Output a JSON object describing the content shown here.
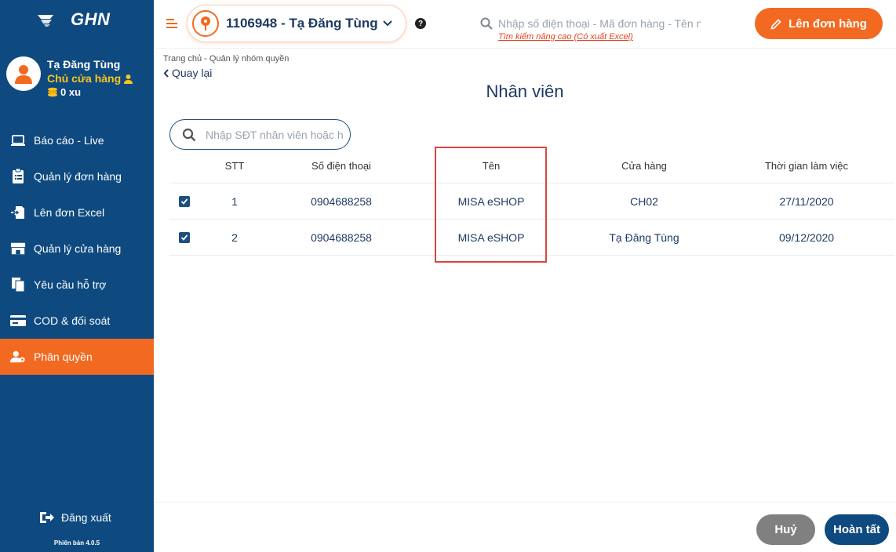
{
  "brand": {
    "logo_text": "GHN"
  },
  "user": {
    "name": "Tạ Đăng Tùng",
    "role": "Chủ cửa hàng",
    "coins": "0 xu"
  },
  "sidebar": {
    "items": [
      {
        "label": "Báo cáo - Live",
        "icon": "monitor-icon"
      },
      {
        "label": "Quản lý đơn hàng",
        "icon": "clipboard-icon"
      },
      {
        "label": "Lên đơn Excel",
        "icon": "file-import-icon"
      },
      {
        "label": "Quản lý cửa hàng",
        "icon": "store-icon"
      },
      {
        "label": "Yêu cầu hỗ trợ",
        "icon": "documents-icon"
      },
      {
        "label": "COD & đối soát",
        "icon": "card-icon"
      },
      {
        "label": "Phân quyền",
        "icon": "user-gear-icon",
        "active": true
      }
    ],
    "logout_label": "Đăng xuất",
    "version": "Phiên bản 4.0.5"
  },
  "header": {
    "shop_label": "1106948 - Tạ Đăng Tùng",
    "search_placeholder": "Nhập số điện thoại - Mã đơn hàng - Tên người nhận",
    "advanced_search": "Tìm kiếm nâng cao (Có xuất Excel)",
    "create_order_label": "Lên đơn hàng"
  },
  "colors": {
    "primary": "#0e4a80",
    "accent": "#f26a21",
    "highlight": "#d9463c",
    "cancel": "#808080"
  },
  "breadcrumb": "Trang chủ - Quản lý nhóm quyền",
  "back_label": "Quay lại",
  "page_title": "Nhân viên",
  "employee_search": {
    "placeholder": "Nhập SĐT nhân viên hoặc họ tên"
  },
  "table": {
    "headers": {
      "stt": "STT",
      "phone": "Số điện thoại",
      "name": "Tên",
      "shop": "Cửa hàng",
      "time": "Thời gian làm việc"
    },
    "rows": [
      {
        "checked": true,
        "stt": "1",
        "phone": "0904688258",
        "name": "MISA eSHOP",
        "shop": "CH02",
        "time": "27/11/2020"
      },
      {
        "checked": true,
        "stt": "2",
        "phone": "0904688258",
        "name": "MISA eSHOP",
        "shop": "Tạ Đăng Tùng",
        "time": "09/12/2020"
      }
    ]
  },
  "footer": {
    "cancel_label": "Huỷ",
    "done_label": "Hoàn tất"
  }
}
